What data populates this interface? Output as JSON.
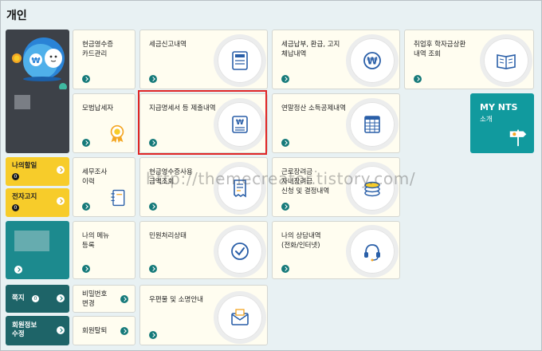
{
  "section_title": "개인",
  "watermark": "http://themecreator.tistory.com/",
  "sidebar": {
    "my_tasks": {
      "label": "나의할일",
      "count": "0"
    },
    "e_notice": {
      "label": "전자고지",
      "count": "0"
    },
    "note": {
      "label": "쪽지",
      "count": "0"
    },
    "member_edit": {
      "label": "회원정보\n수정"
    }
  },
  "tiles": {
    "cash_receipt": "현금영수증\n카드관리",
    "tax_report": "세금신고내역",
    "tax_payment": "세금납부, 환급, 고지\n체납내역",
    "student_loan": "취업후 학자금상환\n내역 조회",
    "model_taxpayer": "모범납세자",
    "payment_statement": "지급명세서 등 제출내역",
    "year_end": "연말정산 소득공제내역",
    "tax_audit": "세무조사\n이력",
    "cash_receipt_usage": "현금영수증사용\n금액조회",
    "earned_income": "근로장려금 ·\n자녀장려금\n신청 및 결정내역",
    "my_menu": "나의 메뉴\n등록",
    "civil_status": "민원처리상태",
    "consult_history": "나의 상담내역\n(전화/인터넷)",
    "password_change": "비밀번호\n변경",
    "withdraw": "회원탈퇴",
    "mail_guide": "우편물 및 소명안내"
  },
  "mynts": {
    "title": "MY NTS",
    "subtitle": "소개"
  },
  "icons": {
    "tax_report": "tax-document-icon",
    "tax_payment": "won-coin-icon",
    "student_loan": "open-book-icon",
    "model_taxpayer": "medal-icon",
    "payment_statement": "won-statement-icon",
    "year_end": "spreadsheet-icon",
    "tax_audit": "notebook-icon",
    "cash_receipt_usage": "receipt-icon",
    "earned_income": "coins-icon",
    "civil_status": "check-circle-icon",
    "consult_history": "headset-icon",
    "mail_guide": "envelope-icon"
  },
  "colors": {
    "teal": "#167a7a",
    "gold": "#f7cc2a",
    "highlight": "#e02626",
    "icon_blue": "#2a5fa8"
  }
}
